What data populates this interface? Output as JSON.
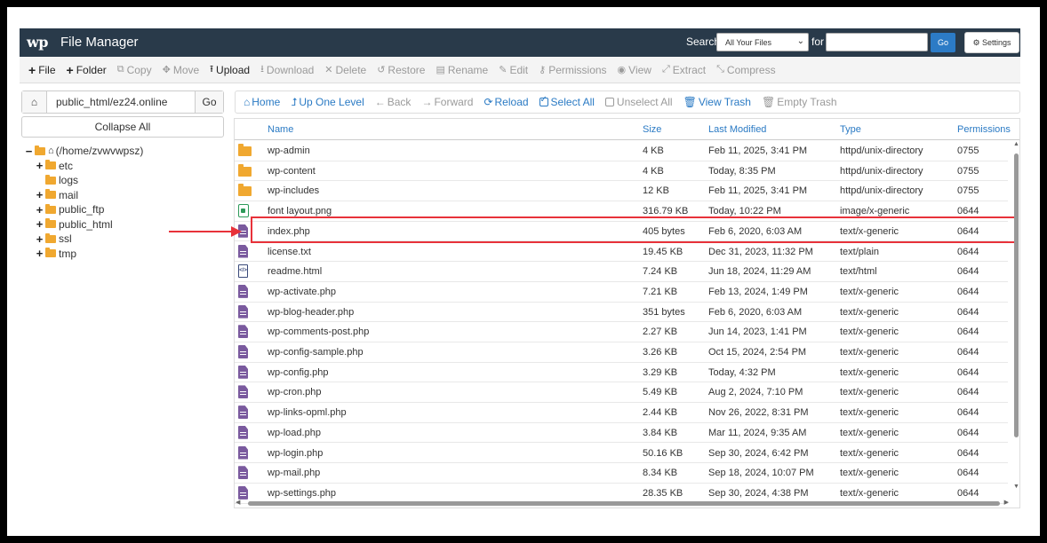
{
  "header": {
    "logo": "wp",
    "title": "File Manager",
    "search_label": "Search",
    "search_scope": "All Your Files",
    "for_label": "for",
    "search_value": "",
    "go_label": "Go",
    "settings_label": "Settings"
  },
  "toolbar": {
    "file": "File",
    "folder": "Folder",
    "copy": "Copy",
    "move": "Move",
    "upload": "Upload",
    "download": "Download",
    "delete": "Delete",
    "restore": "Restore",
    "rename": "Rename",
    "edit": "Edit",
    "permissions": "Permissions",
    "view": "View",
    "extract": "Extract",
    "compress": "Compress"
  },
  "sidebar": {
    "path_value": "public_html/ez24.online",
    "go_label": "Go",
    "collapse_all": "Collapse All",
    "tree": {
      "root": "(/home/zvwvwpsz)",
      "items": [
        "etc",
        "logs",
        "mail",
        "public_ftp",
        "public_html",
        "ssl",
        "tmp"
      ]
    }
  },
  "nav": {
    "home": "Home",
    "up_one_level": "Up One Level",
    "back": "Back",
    "forward": "Forward",
    "reload": "Reload",
    "select_all": "Select All",
    "unselect_all": "Unselect All",
    "view_trash": "View Trash",
    "empty_trash": "Empty Trash"
  },
  "table": {
    "columns": [
      "Name",
      "Size",
      "Last Modified",
      "Type",
      "Permissions"
    ],
    "rows": [
      {
        "icon": "folder-icon",
        "name": "wp-admin",
        "size": "4 KB",
        "modified": "Feb 11, 2025, 3:41 PM",
        "type": "httpd/unix-directory",
        "perms": "0755"
      },
      {
        "icon": "folder-icon",
        "name": "wp-content",
        "size": "4 KB",
        "modified": "Today, 8:35 PM",
        "type": "httpd/unix-directory",
        "perms": "0755"
      },
      {
        "icon": "folder-icon",
        "name": "wp-includes",
        "size": "12 KB",
        "modified": "Feb 11, 2025, 3:41 PM",
        "type": "httpd/unix-directory",
        "perms": "0755"
      },
      {
        "icon": "image-file-icon",
        "name": "font layout.png",
        "size": "316.79 KB",
        "modified": "Today, 10:22 PM",
        "type": "image/x-generic",
        "perms": "0644"
      },
      {
        "icon": "text-file-icon",
        "name": "index.php",
        "size": "405 bytes",
        "modified": "Feb 6, 2020, 6:03 AM",
        "type": "text/x-generic",
        "perms": "0644"
      },
      {
        "icon": "text-file-icon",
        "name": "license.txt",
        "size": "19.45 KB",
        "modified": "Dec 31, 2023, 11:32 PM",
        "type": "text/plain",
        "perms": "0644"
      },
      {
        "icon": "html-file-icon",
        "name": "readme.html",
        "size": "7.24 KB",
        "modified": "Jun 18, 2024, 11:29 AM",
        "type": "text/html",
        "perms": "0644"
      },
      {
        "icon": "text-file-icon",
        "name": "wp-activate.php",
        "size": "7.21 KB",
        "modified": "Feb 13, 2024, 1:49 PM",
        "type": "text/x-generic",
        "perms": "0644"
      },
      {
        "icon": "text-file-icon",
        "name": "wp-blog-header.php",
        "size": "351 bytes",
        "modified": "Feb 6, 2020, 6:03 AM",
        "type": "text/x-generic",
        "perms": "0644"
      },
      {
        "icon": "text-file-icon",
        "name": "wp-comments-post.php",
        "size": "2.27 KB",
        "modified": "Jun 14, 2023, 1:41 PM",
        "type": "text/x-generic",
        "perms": "0644"
      },
      {
        "icon": "text-file-icon",
        "name": "wp-config-sample.php",
        "size": "3.26 KB",
        "modified": "Oct 15, 2024, 2:54 PM",
        "type": "text/x-generic",
        "perms": "0644"
      },
      {
        "icon": "text-file-icon",
        "name": "wp-config.php",
        "size": "3.29 KB",
        "modified": "Today, 4:32 PM",
        "type": "text/x-generic",
        "perms": "0644"
      },
      {
        "icon": "text-file-icon",
        "name": "wp-cron.php",
        "size": "5.49 KB",
        "modified": "Aug 2, 2024, 7:10 PM",
        "type": "text/x-generic",
        "perms": "0644"
      },
      {
        "icon": "text-file-icon",
        "name": "wp-links-opml.php",
        "size": "2.44 KB",
        "modified": "Nov 26, 2022, 8:31 PM",
        "type": "text/x-generic",
        "perms": "0644"
      },
      {
        "icon": "text-file-icon",
        "name": "wp-load.php",
        "size": "3.84 KB",
        "modified": "Mar 11, 2024, 9:35 AM",
        "type": "text/x-generic",
        "perms": "0644"
      },
      {
        "icon": "text-file-icon",
        "name": "wp-login.php",
        "size": "50.16 KB",
        "modified": "Sep 30, 2024, 6:42 PM",
        "type": "text/x-generic",
        "perms": "0644"
      },
      {
        "icon": "text-file-icon",
        "name": "wp-mail.php",
        "size": "8.34 KB",
        "modified": "Sep 18, 2024, 10:07 PM",
        "type": "text/x-generic",
        "perms": "0644"
      },
      {
        "icon": "text-file-icon",
        "name": "wp-settings.php",
        "size": "28.35 KB",
        "modified": "Sep 30, 2024, 4:38 PM",
        "type": "text/x-generic",
        "perms": "0644"
      }
    ]
  },
  "colors": {
    "header_bg": "#293a4a",
    "link": "#2a7ac4",
    "highlight": "#e8323a",
    "folder": "#f0a830",
    "file": "#7a5a9e"
  }
}
